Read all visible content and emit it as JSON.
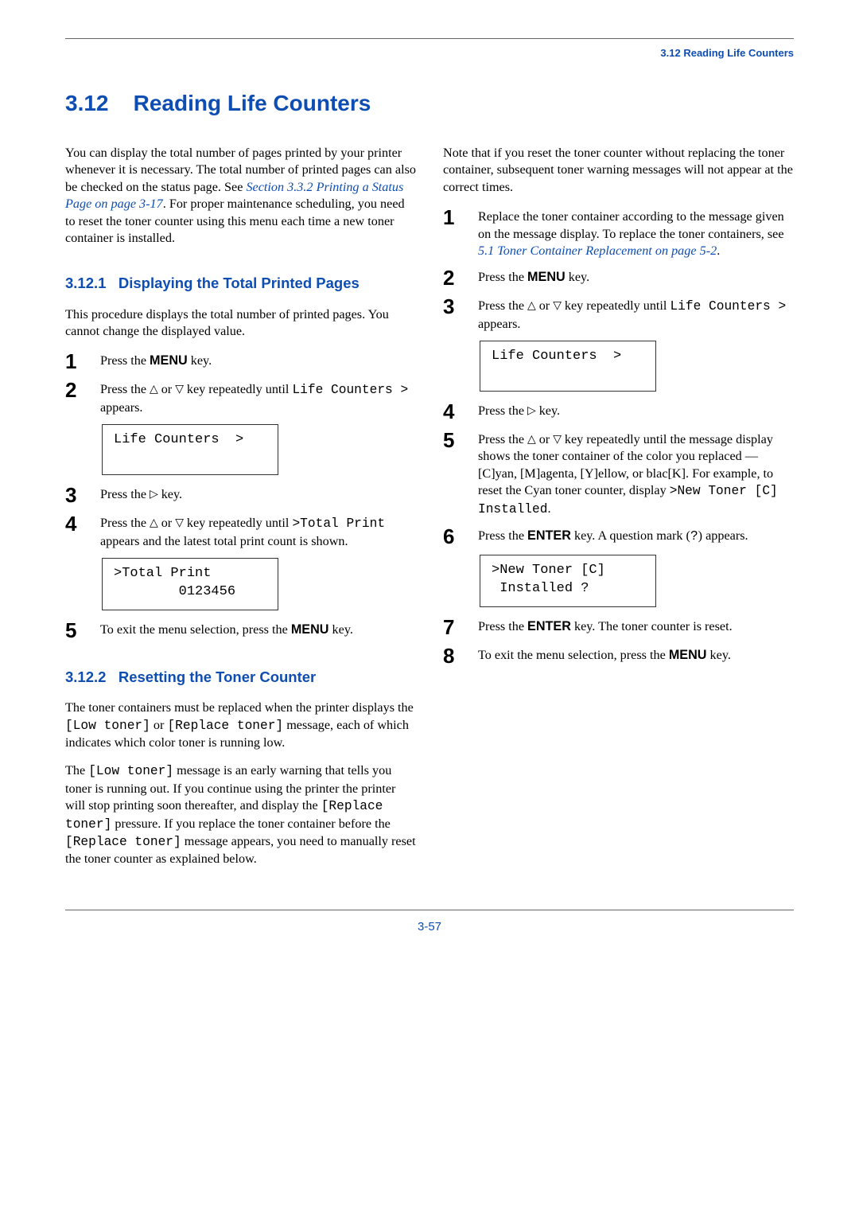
{
  "header": {
    "section_label": "3.12 Reading Life Counters"
  },
  "title": {
    "number": "3.12",
    "text": "Reading Life Counters"
  },
  "left": {
    "intro_a": "You can display the total number of pages printed by your printer whenever it is necessary. The total number of printed pages can also be checked on the status page. See ",
    "intro_link": "Section 3.3.2 Printing a Status Page on page 3-17",
    "intro_b": ". For proper maintenance scheduling, you need to reset the toner counter using this menu each time a new toner container is installed.",
    "sub1_number": "3.12.1",
    "sub1_text": "Displaying the Total Printed Pages",
    "sub1_intro": "This procedure displays the total number of printed pages. You cannot change the displayed value.",
    "s1": {
      "num": "1",
      "a": "Press the ",
      "key": "MENU",
      "b": " key."
    },
    "s2": {
      "num": "2",
      "a": "Press the ",
      "up": "△",
      "mid": " or ",
      "down": "▽",
      "b": " key repeatedly until ",
      "mono": "Life Counters >",
      "c": " appears."
    },
    "disp1": "Life Counters  >",
    "s3": {
      "num": "3",
      "a": "Press the ",
      "right": "▷",
      "b": " key."
    },
    "s4": {
      "num": "4",
      "a": "Press the ",
      "up": "△",
      "mid": " or ",
      "down": "▽",
      "b": " key repeatedly until ",
      "mono": ">Total Print",
      "c": " appears and the latest total print count is shown."
    },
    "disp2_l1": ">Total Print",
    "disp2_l2": "        0123456",
    "s5": {
      "num": "5",
      "a": "To exit the menu selection, press the ",
      "key": "MENU",
      "b": " key."
    },
    "sub2_number": "3.12.2",
    "sub2_text": "Resetting the Toner Counter",
    "sub2_p1_a": "The toner containers must be replaced when the printer displays the ",
    "sub2_p1_m1": "[Low toner]",
    "sub2_p1_b": " or ",
    "sub2_p1_m2": "[Replace toner]",
    "sub2_p1_c": " message, each of which indicates which color toner is running low.",
    "sub2_p2_a": "The ",
    "sub2_p2_m1": "[Low toner]",
    "sub2_p2_b": " message is an early warning that tells you toner is running out. If you continue using the printer the printer will stop printing soon thereafter, and display the ",
    "sub2_p2_m2": "[Replace toner]",
    "sub2_p2_c": " pressure. If you replace the toner container before the ",
    "sub2_p2_m3": "[Replace toner]",
    "sub2_p2_d": " message appears, you need to manually reset the toner counter as explained below."
  },
  "right": {
    "intro": "Note that if you reset the toner counter without replacing the toner container, subsequent toner warning messages will not appear at the correct times.",
    "s1": {
      "num": "1",
      "a": "Replace the toner container according to the message given on the message display. To replace the toner containers, see ",
      "link": "5.1 Toner Container Replacement on page 5-2",
      "b": "."
    },
    "s2": {
      "num": "2",
      "a": "Press the ",
      "key": "MENU",
      "b": " key."
    },
    "s3": {
      "num": "3",
      "a": "Press the ",
      "up": "△",
      "mid": " or ",
      "down": "▽",
      "b": " key repeatedly until ",
      "mono": "Life Counters >",
      "c": " appears."
    },
    "disp1": "Life Counters  >",
    "s4": {
      "num": "4",
      "a": "Press the ",
      "right": "▷",
      "b": " key."
    },
    "s5": {
      "num": "5",
      "a": "Press the ",
      "up": "△",
      "mid": " or ",
      "down": "▽",
      "b": " key repeatedly until the message display shows the toner container of the color you replaced — [C]yan, [M]agenta, [Y]ellow, or blac[K]. For example, to reset the Cyan toner counter, display ",
      "mono": ">New Toner [C] Installed",
      "c": "."
    },
    "s6": {
      "num": "6",
      "a": "Press the ",
      "key": "ENTER",
      "b": " key. A question mark (",
      "mono": "?",
      "c": ") appears."
    },
    "disp2_l1": ">New Toner [C]",
    "disp2_l2": " Installed ?",
    "s7": {
      "num": "7",
      "a": "Press the ",
      "key": "ENTER",
      "b": " key. The toner counter is reset."
    },
    "s8": {
      "num": "8",
      "a": "To exit the menu selection, press the ",
      "key": "MENU",
      "b": " key."
    }
  },
  "footer": {
    "page_number": "3-57"
  }
}
